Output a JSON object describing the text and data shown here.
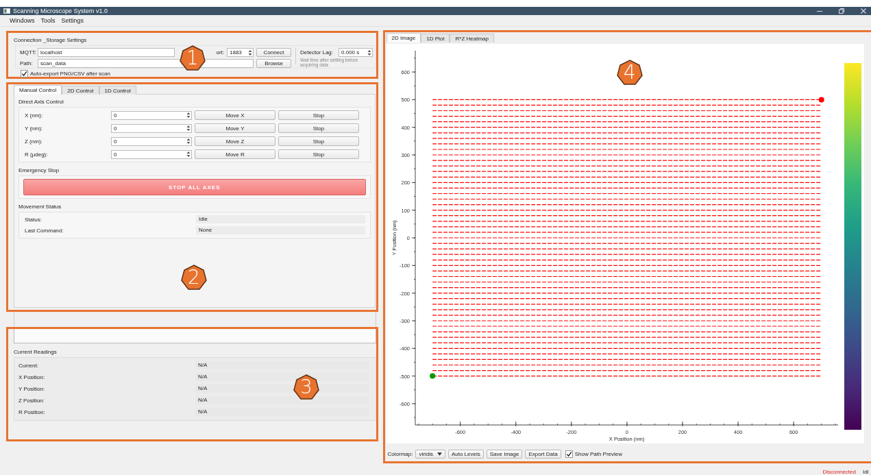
{
  "window": {
    "title": "Scanning Microscope System v1.0"
  },
  "menu": [
    "Windows",
    "Tools",
    "Settings"
  ],
  "connection": {
    "title": "Connection _Storage Settings",
    "mqtt_label": "MQTT:",
    "mqtt_host": "localhost",
    "port_label": "ort:",
    "port": "1883",
    "connect_button": "Connect",
    "path_label": "Path:",
    "path": "scan_data",
    "browse_button": "Browse",
    "detector_lag_label": "Detector Lag:",
    "detector_lag": "0.000 s",
    "detector_hint": "Wait time after settling before acquiring data",
    "auto_export": {
      "label": "Auto-export PNG/CSV after scan",
      "checked": true
    }
  },
  "control_tabs": [
    {
      "label": "Manual Control",
      "selected": true
    },
    {
      "label": "2D Control",
      "selected": false
    },
    {
      "label": "1D Control",
      "selected": false
    }
  ],
  "direct_axis": {
    "title": "Direct Axis Control",
    "axes": [
      {
        "label": "X (nm):",
        "value": "0",
        "move_button": "Move X",
        "stop_button": "Stop"
      },
      {
        "label": "Y (nm):",
        "value": "0",
        "move_button": "Move Y",
        "stop_button": "Stop"
      },
      {
        "label": "Z (nm):",
        "value": "0",
        "move_button": "Move Z",
        "stop_button": "Stop"
      },
      {
        "label": "R (μdeg):",
        "value": "0",
        "move_button": "Move R",
        "stop_button": "Stop"
      }
    ]
  },
  "emergency": {
    "title": "Emergency Stop",
    "button": "STOP ALL AXES"
  },
  "movement_status": {
    "title": "Movement Status",
    "rows": [
      {
        "label": "Status:",
        "value": "Idle"
      },
      {
        "label": "Last Command:",
        "value": "None"
      }
    ]
  },
  "readings": {
    "title": "Current Readings",
    "rows": [
      {
        "label": "Current:",
        "value": "N/A"
      },
      {
        "label": "X Position:",
        "value": "N/A"
      },
      {
        "label": "Y Position:",
        "value": "N/A"
      },
      {
        "label": "Z Position:",
        "value": "N/A"
      },
      {
        "label": "R Position:",
        "value": "N/A"
      }
    ]
  },
  "plot_tabs": [
    {
      "label": "2D Image",
      "selected": true
    },
    {
      "label": "1D Plot",
      "selected": false
    },
    {
      "label": "R*Z Heatmap",
      "selected": false
    }
  ],
  "plot": {
    "chart_data": {
      "type": "line",
      "xlabel": "X Position (nm)",
      "ylabel": "Y Position (nm)",
      "xlim": [
        -762,
        760
      ],
      "ylim": [
        -677,
        677
      ],
      "xticks": [
        -600,
        -400,
        -200,
        0,
        200,
        400,
        600
      ],
      "yticks": [
        -600,
        -500,
        -400,
        -300,
        -200,
        -100,
        0,
        100,
        200,
        300,
        400,
        500,
        600
      ],
      "x": [
        -700,
        700
      ],
      "series": [
        {
          "color": "#ff0000",
          "line_style": "dashed",
          "values": [
            -500,
            -500
          ]
        },
        {
          "color": "#ff0000",
          "line_style": "dashed",
          "values": [
            -480,
            -480
          ]
        },
        {
          "color": "#ff0000",
          "line_style": "dashed",
          "values": [
            -460,
            -460
          ]
        },
        {
          "color": "#ff0000",
          "line_style": "dashed",
          "values": [
            -440,
            -440
          ]
        },
        {
          "color": "#ff0000",
          "line_style": "dashed",
          "values": [
            -420,
            -420
          ]
        },
        {
          "color": "#ff0000",
          "line_style": "dashed",
          "values": [
            -400,
            -400
          ]
        },
        {
          "color": "#ff0000",
          "line_style": "dashed",
          "values": [
            -380,
            -380
          ]
        },
        {
          "color": "#ff0000",
          "line_style": "dashed",
          "values": [
            -360,
            -360
          ]
        },
        {
          "color": "#ff0000",
          "line_style": "dashed",
          "values": [
            -340,
            -340
          ]
        },
        {
          "color": "#ff0000",
          "line_style": "dashed",
          "values": [
            -320,
            -320
          ]
        },
        {
          "color": "#ff0000",
          "line_style": "dashed",
          "values": [
            -300,
            -300
          ]
        },
        {
          "color": "#ff0000",
          "line_style": "dashed",
          "values": [
            -280,
            -280
          ]
        },
        {
          "color": "#ff0000",
          "line_style": "dashed",
          "values": [
            -260,
            -260
          ]
        },
        {
          "color": "#ff0000",
          "line_style": "dashed",
          "values": [
            -240,
            -240
          ]
        },
        {
          "color": "#ff0000",
          "line_style": "dashed",
          "values": [
            -220,
            -220
          ]
        },
        {
          "color": "#ff0000",
          "line_style": "dashed",
          "values": [
            -200,
            -200
          ]
        },
        {
          "color": "#ff0000",
          "line_style": "dashed",
          "values": [
            -180,
            -180
          ]
        },
        {
          "color": "#ff0000",
          "line_style": "dashed",
          "values": [
            -160,
            -160
          ]
        },
        {
          "color": "#ff0000",
          "line_style": "dashed",
          "values": [
            -140,
            -140
          ]
        },
        {
          "color": "#ff0000",
          "line_style": "dashed",
          "values": [
            -120,
            -120
          ]
        },
        {
          "color": "#ff0000",
          "line_style": "dashed",
          "values": [
            -100,
            -100
          ]
        },
        {
          "color": "#ff0000",
          "line_style": "dashed",
          "values": [
            -80,
            -80
          ]
        },
        {
          "color": "#ff0000",
          "line_style": "dashed",
          "values": [
            -60,
            -60
          ]
        },
        {
          "color": "#ff0000",
          "line_style": "dashed",
          "values": [
            -40,
            -40
          ]
        },
        {
          "color": "#ff0000",
          "line_style": "dashed",
          "values": [
            -20,
            -20
          ]
        },
        {
          "color": "#ff0000",
          "line_style": "dashed",
          "values": [
            0,
            0
          ]
        },
        {
          "color": "#ff0000",
          "line_style": "dashed",
          "values": [
            20,
            20
          ]
        },
        {
          "color": "#ff0000",
          "line_style": "dashed",
          "values": [
            40,
            40
          ]
        },
        {
          "color": "#ff0000",
          "line_style": "dashed",
          "values": [
            60,
            60
          ]
        },
        {
          "color": "#ff0000",
          "line_style": "dashed",
          "values": [
            80,
            80
          ]
        },
        {
          "color": "#ff0000",
          "line_style": "dashed",
          "values": [
            100,
            100
          ]
        },
        {
          "color": "#ff0000",
          "line_style": "dashed",
          "values": [
            120,
            120
          ]
        },
        {
          "color": "#ff0000",
          "line_style": "dashed",
          "values": [
            140,
            140
          ]
        },
        {
          "color": "#ff0000",
          "line_style": "dashed",
          "values": [
            160,
            160
          ]
        },
        {
          "color": "#ff0000",
          "line_style": "dashed",
          "values": [
            180,
            180
          ]
        },
        {
          "color": "#ff0000",
          "line_style": "dashed",
          "values": [
            200,
            200
          ]
        },
        {
          "color": "#ff0000",
          "line_style": "dashed",
          "values": [
            220,
            220
          ]
        },
        {
          "color": "#ff0000",
          "line_style": "dashed",
          "values": [
            240,
            240
          ]
        },
        {
          "color": "#ff0000",
          "line_style": "dashed",
          "values": [
            260,
            260
          ]
        },
        {
          "color": "#ff0000",
          "line_style": "dashed",
          "values": [
            280,
            280
          ]
        },
        {
          "color": "#ff0000",
          "line_style": "dashed",
          "values": [
            300,
            300
          ]
        },
        {
          "color": "#ff0000",
          "line_style": "dashed",
          "values": [
            320,
            320
          ]
        },
        {
          "color": "#ff0000",
          "line_style": "dashed",
          "values": [
            340,
            340
          ]
        },
        {
          "color": "#ff0000",
          "line_style": "dashed",
          "values": [
            360,
            360
          ]
        },
        {
          "color": "#ff0000",
          "line_style": "dashed",
          "values": [
            380,
            380
          ]
        },
        {
          "color": "#ff0000",
          "line_style": "dashed",
          "values": [
            400,
            400
          ]
        },
        {
          "color": "#ff0000",
          "line_style": "dashed",
          "values": [
            420,
            420
          ]
        },
        {
          "color": "#ff0000",
          "line_style": "dashed",
          "values": [
            440,
            440
          ]
        },
        {
          "color": "#ff0000",
          "line_style": "dashed",
          "values": [
            460,
            460
          ]
        },
        {
          "color": "#ff0000",
          "line_style": "dashed",
          "values": [
            480,
            480
          ]
        },
        {
          "color": "#ff0000",
          "line_style": "dashed",
          "values": [
            500,
            500
          ]
        }
      ]
    },
    "path_markers": [
      {
        "kind": "start",
        "color": "#009900"
      },
      {
        "kind": "end",
        "color": "#ff0000"
      }
    ]
  },
  "plot_toolbar": {
    "colormap_label": "Colormap:",
    "colormap": "viridis",
    "buttons": [
      "Auto Levels",
      "Save Image",
      "Export Data"
    ],
    "show_path_preview": {
      "label": "Show Path Preview",
      "checked": true
    }
  },
  "status_bar": {
    "connection": "Disconnected",
    "state": "Idl"
  },
  "callouts": [
    {
      "label": "1"
    },
    {
      "label": "2"
    },
    {
      "label": "3"
    },
    {
      "label": "4"
    }
  ]
}
